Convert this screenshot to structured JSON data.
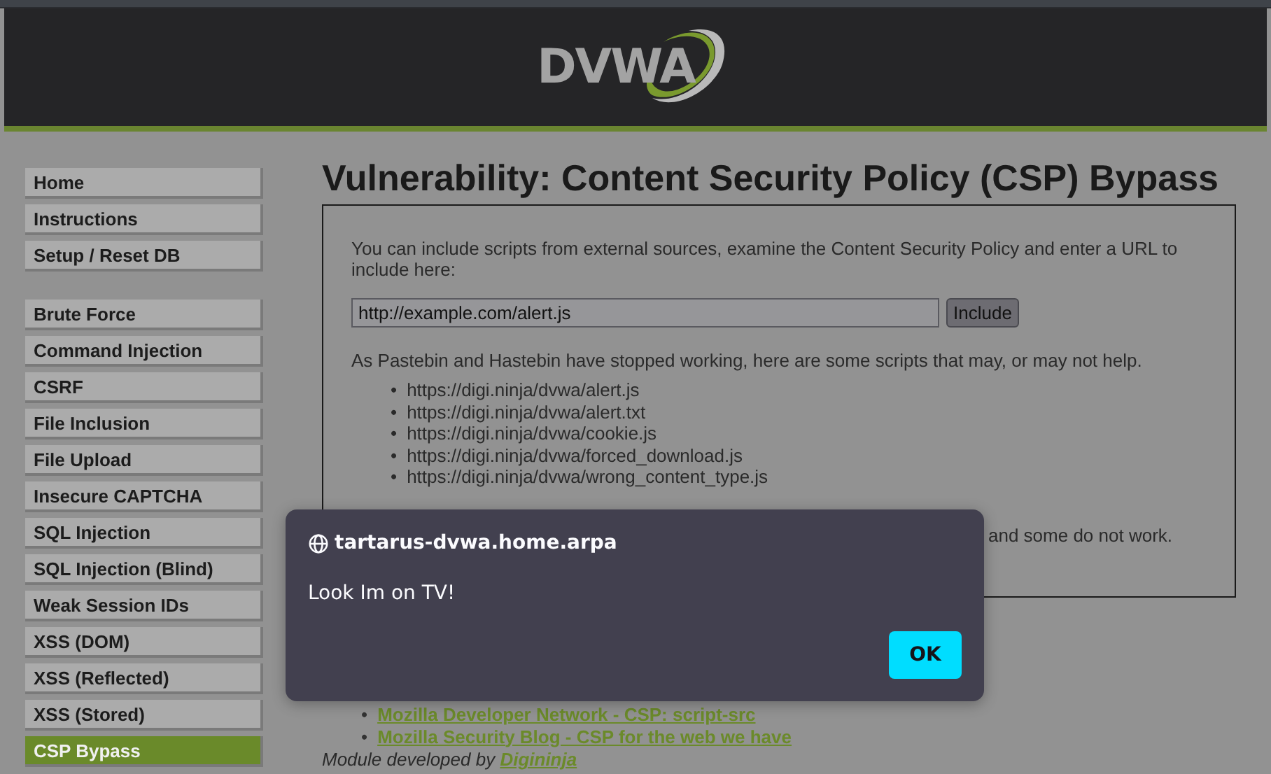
{
  "header": {
    "logo": "DVWA"
  },
  "sidebar": {
    "groups": [
      [
        {
          "label": "Home",
          "selected": false
        },
        {
          "label": "Instructions",
          "selected": false
        },
        {
          "label": "Setup / Reset DB",
          "selected": false
        }
      ],
      [
        {
          "label": "Brute Force",
          "selected": false
        },
        {
          "label": "Command Injection",
          "selected": false
        },
        {
          "label": "CSRF",
          "selected": false
        },
        {
          "label": "File Inclusion",
          "selected": false
        },
        {
          "label": "File Upload",
          "selected": false
        },
        {
          "label": "Insecure CAPTCHA",
          "selected": false
        },
        {
          "label": "SQL Injection",
          "selected": false
        },
        {
          "label": "SQL Injection (Blind)",
          "selected": false
        },
        {
          "label": "Weak Session IDs",
          "selected": false
        },
        {
          "label": "XSS (DOM)",
          "selected": false
        },
        {
          "label": "XSS (Reflected)",
          "selected": false
        },
        {
          "label": "XSS (Stored)",
          "selected": false
        },
        {
          "label": "CSP Bypass",
          "selected": true
        }
      ]
    ]
  },
  "main": {
    "title": "Vulnerability: Content Security Policy (CSP) Bypass",
    "intro": "You can include scripts from external sources, examine the Content Security Policy and enter a URL to include here:",
    "url_field": {
      "value": "http://example.com/alert.js"
    },
    "include_button": "Include",
    "note": "As Pastebin and Hastebin have stopped working, here are some scripts that may, or may not help.",
    "scripts": [
      {
        "bullet": "•",
        "url": "https://digi.ninja/dvwa/alert.js"
      },
      {
        "bullet": "•",
        "url": "https://digi.ninja/dvwa/alert.txt"
      },
      {
        "bullet": "•",
        "url": "https://digi.ninja/dvwa/cookie.js"
      },
      {
        "bullet": "•",
        "url": "https://digi.ninja/dvwa/forced_download.js"
      },
      {
        "bullet": "•",
        "url": "https://digi.ninja/dvwa/wrong_content_type.js"
      }
    ],
    "partial_note": "and some do not work.",
    "links": [
      {
        "bullet": "•",
        "label": "Mozilla Developer Network - CSP: script-src"
      },
      {
        "bullet": "•",
        "label": "Mozilla Security Blog - CSP for the web we have"
      }
    ],
    "credit": {
      "text": "Module developed by ",
      "link": "Digininja"
    }
  },
  "dialog": {
    "origin": "tartarus-dvwa.home.arpa",
    "message": "Look Im on TV!",
    "button": "OK"
  }
}
